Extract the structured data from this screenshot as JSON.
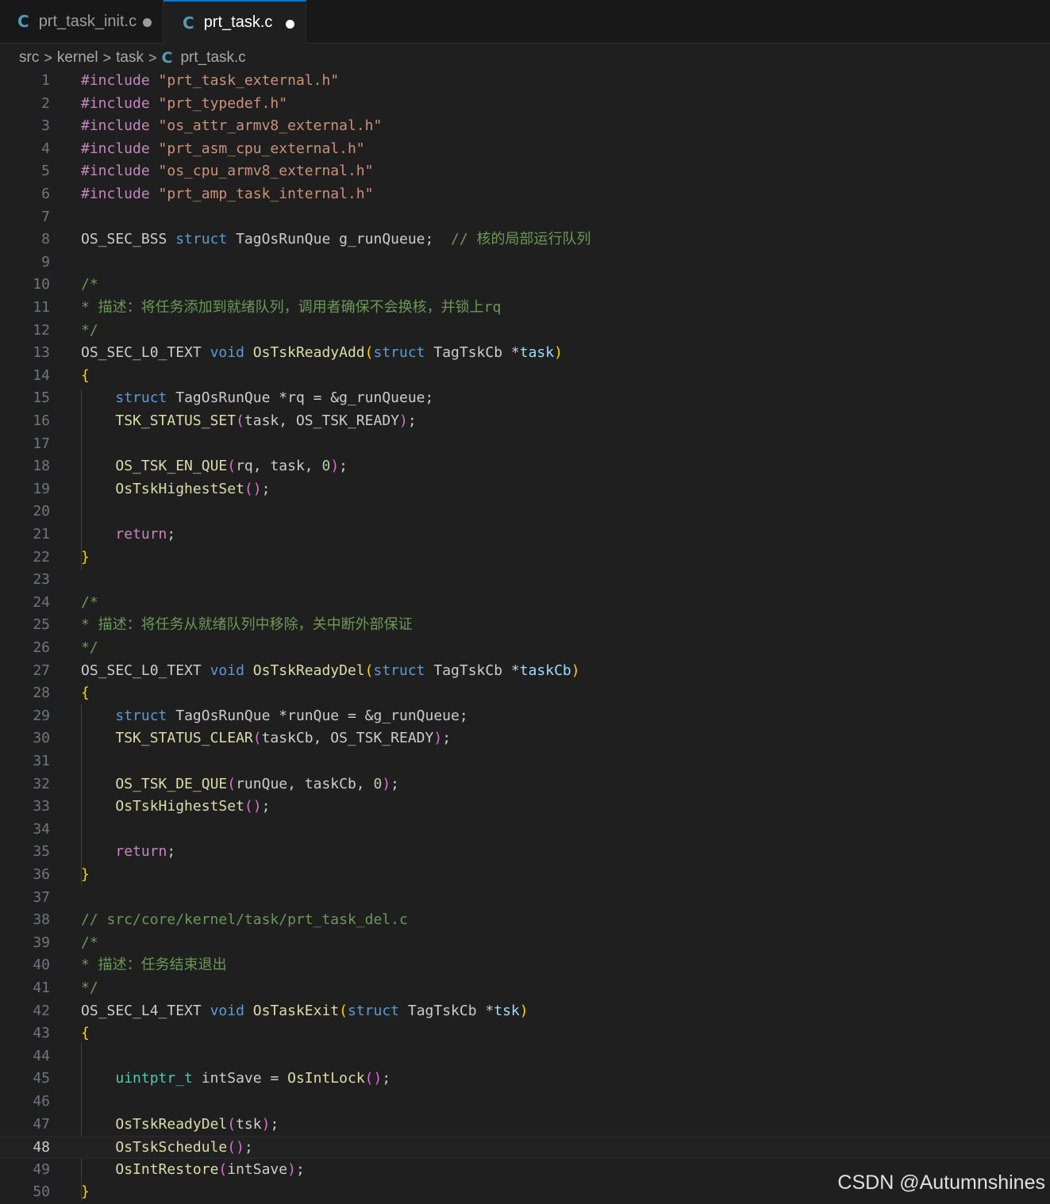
{
  "tabs": [
    {
      "label": "prt_task_init.c",
      "icon": "C",
      "modified": true,
      "active": false
    },
    {
      "label": "prt_task.c",
      "icon": "C",
      "modified": true,
      "active": true
    }
  ],
  "breadcrumb": {
    "items": [
      "src",
      "kernel",
      "task"
    ],
    "file_icon": "C",
    "file": "prt_task.c"
  },
  "editor": {
    "current_line": 48,
    "line_numbers": [
      "1",
      "2",
      "3",
      "4",
      "5",
      "6",
      "7",
      "8",
      "9",
      "10",
      "11",
      "12",
      "13",
      "14",
      "15",
      "16",
      "17",
      "18",
      "19",
      "20",
      "21",
      "22",
      "23",
      "24",
      "25",
      "26",
      "27",
      "28",
      "29",
      "30",
      "31",
      "32",
      "33",
      "34",
      "35",
      "36",
      "37",
      "38",
      "39",
      "40",
      "41",
      "42",
      "43",
      "44",
      "45",
      "46",
      "47",
      "48",
      "49",
      "50"
    ],
    "lines": [
      [
        [
          "dir",
          "#include "
        ],
        [
          "str",
          "\"prt_task_external.h\""
        ]
      ],
      [
        [
          "dir",
          "#include "
        ],
        [
          "str",
          "\"prt_typedef.h\""
        ]
      ],
      [
        [
          "dir",
          "#include "
        ],
        [
          "str",
          "\"os_attr_armv8_external.h\""
        ]
      ],
      [
        [
          "dir",
          "#include "
        ],
        [
          "str",
          "\"prt_asm_cpu_external.h\""
        ]
      ],
      [
        [
          "dir",
          "#include "
        ],
        [
          "str",
          "\"os_cpu_armv8_external.h\""
        ]
      ],
      [
        [
          "dir",
          "#include "
        ],
        [
          "str",
          "\"prt_amp_task_internal.h\""
        ]
      ],
      [],
      [
        [
          "plain",
          "OS_SEC_BSS "
        ],
        [
          "kw",
          "struct"
        ],
        [
          "plain",
          " TagOsRunQue g_runQueue;  "
        ],
        [
          "com",
          "// 核的局部运行队列"
        ]
      ],
      [],
      [
        [
          "com",
          "/*"
        ]
      ],
      [
        [
          "com",
          "* 描述：将任务添加到就绪队列，调用者确保不会换核，并锁上rq"
        ]
      ],
      [
        [
          "com",
          "*/"
        ]
      ],
      [
        [
          "plain",
          "OS_SEC_L0_TEXT "
        ],
        [
          "kw",
          "void"
        ],
        [
          "plain",
          " "
        ],
        [
          "fn",
          "OsTskReadyAdd"
        ],
        [
          "b1",
          "("
        ],
        [
          "kw",
          "struct"
        ],
        [
          "plain",
          " TagTskCb *"
        ],
        [
          "var",
          "task"
        ],
        [
          "b1",
          ")"
        ]
      ],
      [
        [
          "b1",
          "{"
        ]
      ],
      [
        [
          "plain",
          "    "
        ],
        [
          "kw",
          "struct"
        ],
        [
          "plain",
          " TagOsRunQue *rq = &g_runQueue;"
        ]
      ],
      [
        [
          "plain",
          "    "
        ],
        [
          "fn",
          "TSK_STATUS_SET"
        ],
        [
          "b2",
          "("
        ],
        [
          "plain",
          "task, OS_TSK_READY"
        ],
        [
          "b2",
          ")"
        ],
        [
          "plain",
          ";"
        ]
      ],
      [],
      [
        [
          "plain",
          "    "
        ],
        [
          "fn",
          "OS_TSK_EN_QUE"
        ],
        [
          "b2",
          "("
        ],
        [
          "plain",
          "rq, task, "
        ],
        [
          "num",
          "0"
        ],
        [
          "b2",
          ")"
        ],
        [
          "plain",
          ";"
        ]
      ],
      [
        [
          "plain",
          "    "
        ],
        [
          "fn",
          "OsTskHighestSet"
        ],
        [
          "b2",
          "()"
        ],
        [
          "plain",
          ";"
        ]
      ],
      [],
      [
        [
          "plain",
          "    "
        ],
        [
          "ctl",
          "return"
        ],
        [
          "plain",
          ";"
        ]
      ],
      [
        [
          "b1",
          "}"
        ]
      ],
      [],
      [
        [
          "com",
          "/*"
        ]
      ],
      [
        [
          "com",
          "* 描述：将任务从就绪队列中移除，关中断外部保证"
        ]
      ],
      [
        [
          "com",
          "*/"
        ]
      ],
      [
        [
          "plain",
          "OS_SEC_L0_TEXT "
        ],
        [
          "kw",
          "void"
        ],
        [
          "plain",
          " "
        ],
        [
          "fn",
          "OsTskReadyDel"
        ],
        [
          "b1",
          "("
        ],
        [
          "kw",
          "struct"
        ],
        [
          "plain",
          " TagTskCb *"
        ],
        [
          "var",
          "taskCb"
        ],
        [
          "b1",
          ")"
        ]
      ],
      [
        [
          "b1",
          "{"
        ]
      ],
      [
        [
          "plain",
          "    "
        ],
        [
          "kw",
          "struct"
        ],
        [
          "plain",
          " TagOsRunQue *runQue = &g_runQueue;"
        ]
      ],
      [
        [
          "plain",
          "    "
        ],
        [
          "fn",
          "TSK_STATUS_CLEAR"
        ],
        [
          "b2",
          "("
        ],
        [
          "plain",
          "taskCb, OS_TSK_READY"
        ],
        [
          "b2",
          ")"
        ],
        [
          "plain",
          ";"
        ]
      ],
      [],
      [
        [
          "plain",
          "    "
        ],
        [
          "fn",
          "OS_TSK_DE_QUE"
        ],
        [
          "b2",
          "("
        ],
        [
          "plain",
          "runQue, taskCb, "
        ],
        [
          "num",
          "0"
        ],
        [
          "b2",
          ")"
        ],
        [
          "plain",
          ";"
        ]
      ],
      [
        [
          "plain",
          "    "
        ],
        [
          "fn",
          "OsTskHighestSet"
        ],
        [
          "b2",
          "()"
        ],
        [
          "plain",
          ";"
        ]
      ],
      [],
      [
        [
          "plain",
          "    "
        ],
        [
          "ctl",
          "return"
        ],
        [
          "plain",
          ";"
        ]
      ],
      [
        [
          "b1",
          "}"
        ]
      ],
      [],
      [
        [
          "com",
          "// src/core/kernel/task/prt_task_del.c"
        ]
      ],
      [
        [
          "com",
          "/*"
        ]
      ],
      [
        [
          "com",
          "* 描述：任务结束退出"
        ]
      ],
      [
        [
          "com",
          "*/"
        ]
      ],
      [
        [
          "plain",
          "OS_SEC_L4_TEXT "
        ],
        [
          "kw",
          "void"
        ],
        [
          "plain",
          " "
        ],
        [
          "fn",
          "OsTaskExit"
        ],
        [
          "b1",
          "("
        ],
        [
          "kw",
          "struct"
        ],
        [
          "plain",
          " TagTskCb *"
        ],
        [
          "var",
          "tsk"
        ],
        [
          "b1",
          ")"
        ]
      ],
      [
        [
          "b1",
          "{"
        ]
      ],
      [],
      [
        [
          "plain",
          "    "
        ],
        [
          "type",
          "uintptr_t"
        ],
        [
          "plain",
          " intSave = "
        ],
        [
          "fn",
          "OsIntLock"
        ],
        [
          "b2",
          "()"
        ],
        [
          "plain",
          ";"
        ]
      ],
      [],
      [
        [
          "plain",
          "    "
        ],
        [
          "fn",
          "OsTskReadyDel"
        ],
        [
          "b2",
          "("
        ],
        [
          "plain",
          "tsk"
        ],
        [
          "b2",
          ")"
        ],
        [
          "plain",
          ";"
        ]
      ],
      [
        [
          "plain",
          "    "
        ],
        [
          "fn",
          "OsTskSchedule"
        ],
        [
          "b2",
          "()"
        ],
        [
          "plain",
          ";"
        ]
      ],
      [
        [
          "plain",
          "    "
        ],
        [
          "fn",
          "OsIntRestore"
        ],
        [
          "b2",
          "("
        ],
        [
          "plain",
          "intSave"
        ],
        [
          "b2",
          ")"
        ],
        [
          "plain",
          ";"
        ]
      ],
      [
        [
          "b1",
          "}"
        ]
      ]
    ]
  },
  "watermark": "CSDN @Autumnshines",
  "colors": {
    "background": "#1f1f1f",
    "directive": "#c586c0",
    "string": "#ce9178",
    "keyword": "#569cd6",
    "function": "#dcdcaa",
    "comment": "#6a9955",
    "number": "#b5cea8",
    "variable": "#9cdcfe",
    "bracket1": "#ffd700",
    "bracket2": "#da70d6"
  }
}
